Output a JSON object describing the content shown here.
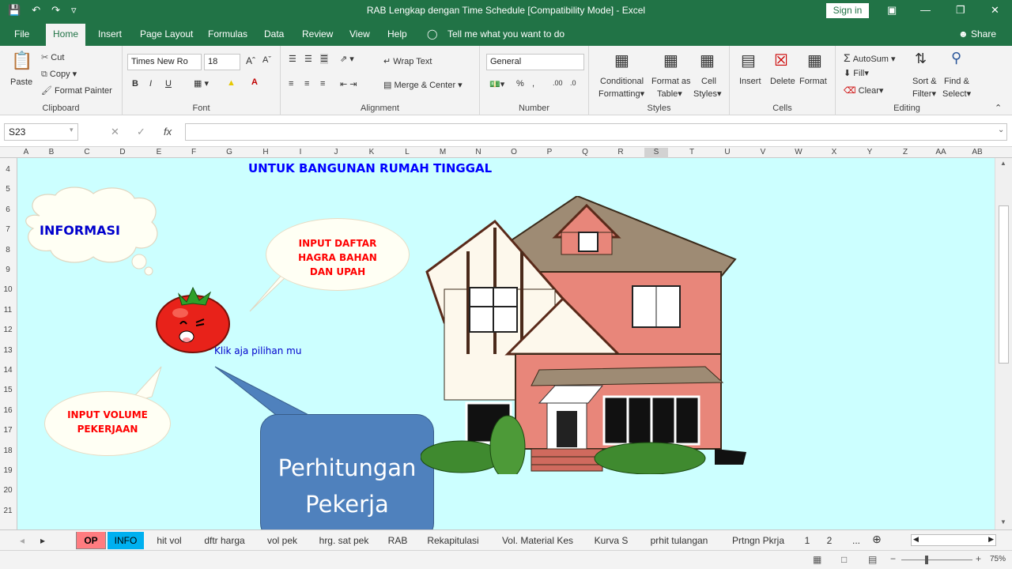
{
  "window": {
    "title": "RAB Lengkap dengan Time Schedule  [Compatibility Mode]  -  Excel",
    "signin": "Sign in"
  },
  "menu_tabs": [
    "File",
    "Home",
    "Insert",
    "Page Layout",
    "Formulas",
    "Data",
    "Review",
    "View",
    "Help"
  ],
  "tell_me": "Tell me what you want to do",
  "share": "Share",
  "ribbon": {
    "clipboard": {
      "label": "Clipboard",
      "paste": "Paste",
      "cut": "Cut",
      "copy": "Copy",
      "format_painter": "Format Painter"
    },
    "font": {
      "label": "Font",
      "font_name": "Times New Ro",
      "font_size": "18"
    },
    "alignment": {
      "label": "Alignment",
      "wrap_text": "Wrap Text",
      "merge_center": "Merge & Center"
    },
    "number": {
      "label": "Number",
      "format": "General"
    },
    "styles": {
      "label": "Styles",
      "conditional": "Conditional",
      "conditional2": "Formatting",
      "format_as": "Format as",
      "format_as2": "Table",
      "cell": "Cell",
      "cell2": "Styles"
    },
    "cells": {
      "label": "Cells",
      "insert": "Insert",
      "delete": "Delete",
      "format": "Format"
    },
    "editing": {
      "label": "Editing",
      "autosum": "AutoSum",
      "fill": "Fill",
      "clear": "Clear",
      "sort": "Sort &",
      "sort2": "Filter",
      "find": "Find &",
      "find2": "Select"
    }
  },
  "formula": {
    "name_box": "S23",
    "fx": "fx",
    "value": ""
  },
  "columns": [
    "A",
    "B",
    "C",
    "D",
    "E",
    "F",
    "G",
    "H",
    "I",
    "J",
    "K",
    "L",
    "M",
    "N",
    "O",
    "P",
    "Q",
    "R",
    "S",
    "T",
    "U",
    "V",
    "W",
    "X",
    "Y",
    "Z",
    "AA",
    "AB"
  ],
  "rows": [
    "4",
    "5",
    "6",
    "7",
    "8",
    "9",
    "10",
    "11",
    "12",
    "13",
    "14",
    "15",
    "16",
    "17",
    "18",
    "19",
    "20",
    "21"
  ],
  "sheet": {
    "heading": "UNTUK BANGUNAN RUMAH TINGGAL",
    "info_cloud": "INFORMASI",
    "bubble_daftar": [
      "INPUT DAFTAR",
      "HAGRA BAHAN",
      "DAN UPAH"
    ],
    "bubble_volume": [
      "INPUT VOLUME",
      "PEKERJAAN"
    ],
    "klik_text": "Klik aja pilihan mu",
    "callout": [
      "Perhitungan",
      "Pekerja"
    ]
  },
  "sheet_tabs": [
    "OP",
    "INFO",
    "hit vol",
    "dftr harga",
    "vol pek",
    "hrg. sat pek",
    "RAB",
    "Rekapitulasi",
    "Vol. Material Kes",
    "Kurva S",
    "prhit tulangan",
    "Prtngn Pkrja",
    "1",
    "2",
    "..."
  ],
  "status": {
    "zoom": "75%"
  },
  "colors": {
    "excel_green": "#217346",
    "sheet_bg": "#ccffff",
    "callout_blue": "#4f81bd",
    "tab_op": "#ff7c80",
    "tab_info": "#00b0f0"
  }
}
